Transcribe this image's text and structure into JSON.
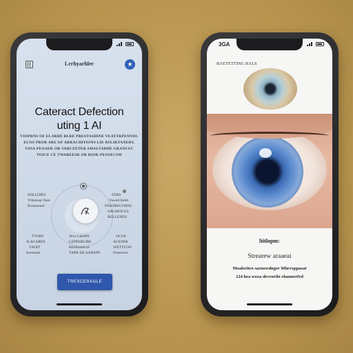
{
  "left_phone": {
    "status_time": "",
    "app_title": "Lrrhyarhler",
    "hero_title_line1": "Cateract Defection",
    "hero_title_line2": "uting 1 AI",
    "description_lines": [
      "VIOPRNS OF ELARDE BLRE PRESTASHINE VEATTRPENNIO.",
      "ECOS PROR ARE OF ARRACHITIONS LIE RSLIKTANERS.",
      "VIOA PEOAEK OR VARCEETER SMALTARDE GRANCEC",
      "TOICE CE TWAREESR OR RIOK PEOSECOD"
    ],
    "feature_top_left": [
      "SHLLOIES",
      "Vtbrstoar flare",
      "Rveaseoed"
    ],
    "feature_top_right": [
      "FERS",
      "Vawed Eehh",
      "PSSORECURNS",
      "SACMOCUS",
      "RELLENES"
    ],
    "feature_bottom_left": [
      "TTORT",
      "JLACARES",
      "TAOIT",
      "Sorreaoh"
    ],
    "feature_bottom_center": [
      "Alvs LdebP6",
      "LEPBOEGRE",
      "Rimbuarecxe",
      "TAPR ER AAKEPS"
    ],
    "feature_bottom_right": [
      "OCOS",
      "ACEDSE",
      "WETTCOO",
      "Ferecewe"
    ],
    "cta_label": "TRESCERAGLE"
  },
  "right_phone": {
    "status_time": "3GA",
    "header_label": "BAETETTING RALS",
    "result_label_1": "ltitlopm:",
    "result_label_2": "Strearew araaeai",
    "result_label_3": "Moaleritro sarnowdnger Mhrrxppasat",
    "result_label_4": "124 hra woxa decrortfo ehannerfrd"
  },
  "colors": {
    "accent": "#2f57ab",
    "badge": "#2f5fb8",
    "background": "#b8954f"
  },
  "icons": {
    "left_menu": "sidebar-icon",
    "left_badge": "star-icon",
    "scan": "eye-scan-icon"
  }
}
